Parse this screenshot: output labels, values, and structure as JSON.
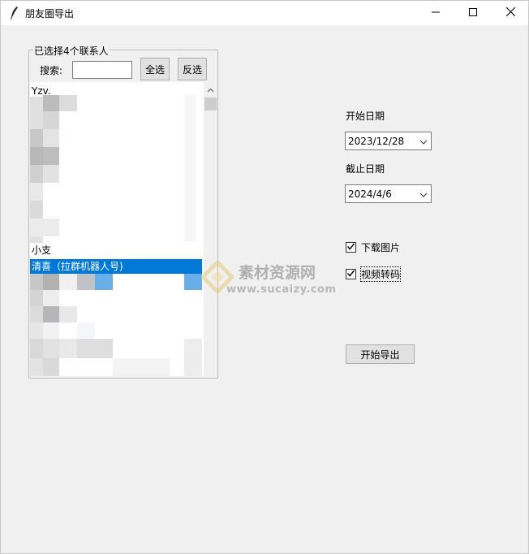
{
  "window": {
    "title": "朋友圈导出",
    "icons": [
      "feather-icon",
      "minimize-icon",
      "maximize-icon",
      "close-icon"
    ]
  },
  "contacts": {
    "group_label": "已选择4个联系人",
    "search_label": "搜索:",
    "search_value": "",
    "select_all_label": "全选",
    "invert_label": "反选",
    "list_items": [
      {
        "text": "Yzv.",
        "selected": false
      },
      {
        "text": "小支",
        "selected": false
      },
      {
        "text": "清喜（拉群机器人号)",
        "selected": true
      }
    ],
    "selection_color": "#0078d7"
  },
  "dates": {
    "start_label": "开始日期",
    "start_value": "2023/12/28",
    "end_label": "截止日期",
    "end_value": "2024/4/6"
  },
  "options": {
    "download_images_label": "下载图片",
    "download_images_checked": true,
    "video_transcode_label": "视频转码",
    "video_transcode_checked": true
  },
  "actions": {
    "export_label": "开始导出"
  },
  "watermark": {
    "title": "素材资源网",
    "url": "www.sucaizy.com"
  }
}
